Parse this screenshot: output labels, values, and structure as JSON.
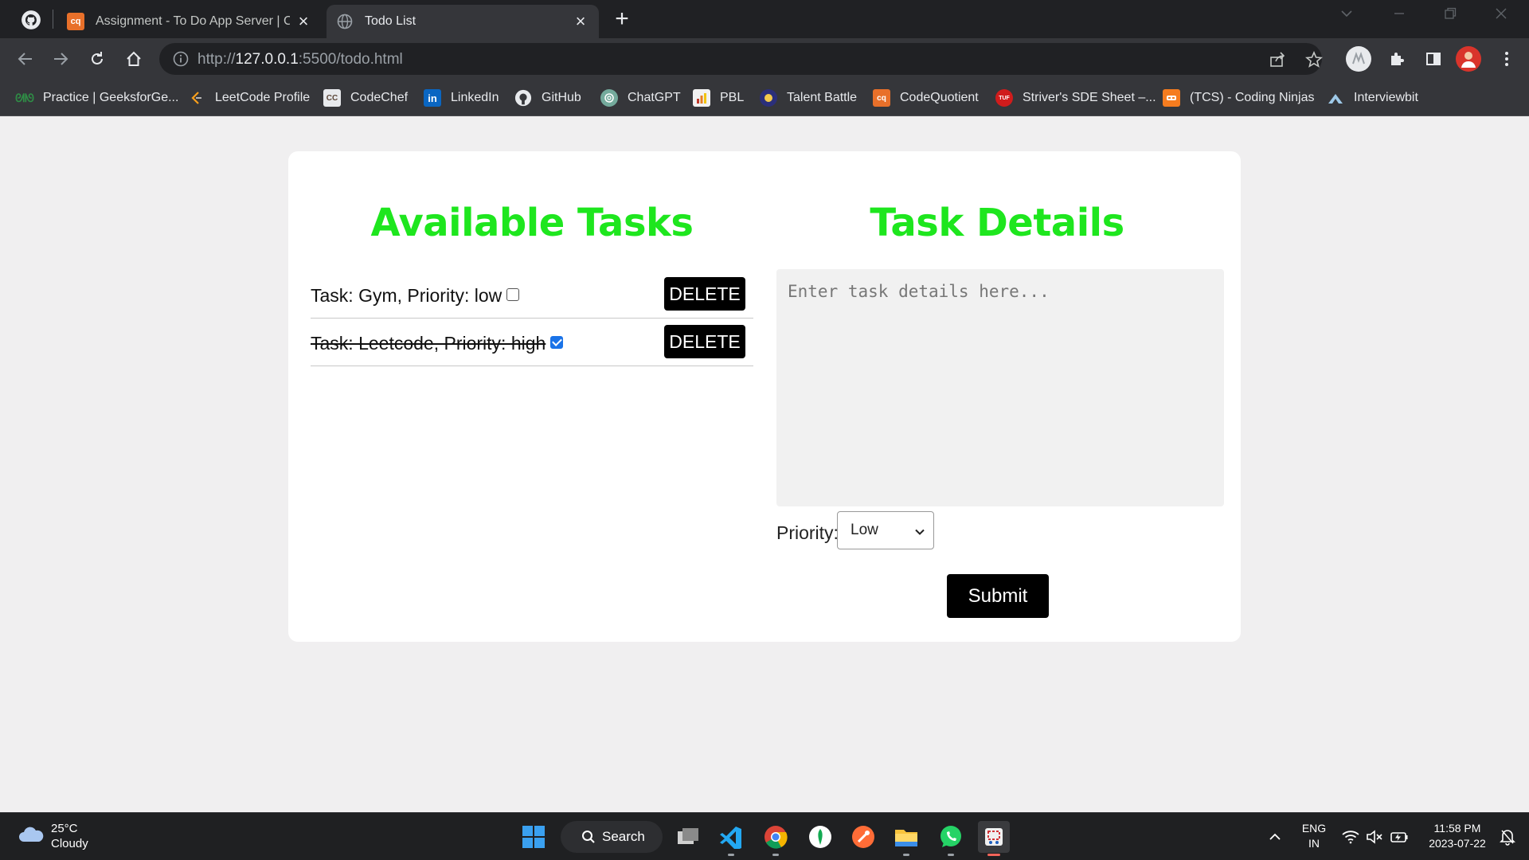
{
  "browser": {
    "tabs": [
      {
        "title": "Assignment - To Do App Server | Co",
        "icon": "codequotient-icon"
      },
      {
        "title": "Todo List",
        "icon": "globe-icon"
      }
    ],
    "url_prefix": "http://",
    "url_host": "127.0.0.1",
    "url_rest": ":5500/todo.html",
    "bookmarks": [
      {
        "label": "Practice | GeeksforGe...",
        "icon": "geeksforgeeks-icon"
      },
      {
        "label": "LeetCode Profile",
        "icon": "leetcode-icon"
      },
      {
        "label": "CodeChef",
        "icon": "codechef-icon"
      },
      {
        "label": "LinkedIn",
        "icon": "linkedin-icon"
      },
      {
        "label": "GitHub",
        "icon": "github-icon"
      },
      {
        "label": "ChatGPT",
        "icon": "chatgpt-icon"
      },
      {
        "label": "PBL",
        "icon": "pbl-icon"
      },
      {
        "label": "Talent Battle",
        "icon": "talent-battle-icon"
      },
      {
        "label": "CodeQuotient",
        "icon": "codequotient-icon"
      },
      {
        "label": "Striver's SDE Sheet –...",
        "icon": "takeuforward-icon"
      },
      {
        "label": "(TCS) - Coding Ninjas",
        "icon": "coding-ninjas-icon"
      },
      {
        "label": "Interviewbit",
        "icon": "interviewbit-icon"
      }
    ]
  },
  "page": {
    "tasks_heading": "Available Tasks",
    "details_heading": "Task Details",
    "tasks": [
      {
        "text": "Task: Gym, Priority: low",
        "done": false,
        "delete_label": "DELETE"
      },
      {
        "text": "Task: Leetcode, Priority: high",
        "done": true,
        "delete_label": "DELETE"
      }
    ],
    "details_placeholder": "Enter task details here...",
    "priority_label": "Priority:",
    "priority_selected": "Low",
    "submit_label": "Submit"
  },
  "taskbar": {
    "temperature": "25°C",
    "condition": "Cloudy",
    "search_label": "Search",
    "language": "ENG",
    "region": "IN",
    "time": "11:58 PM",
    "date": "2023-07-22"
  },
  "colors": {
    "heading_green": "#1ee61e",
    "checkbox_blue": "#1a73e8",
    "chrome_dark": "#202124"
  }
}
